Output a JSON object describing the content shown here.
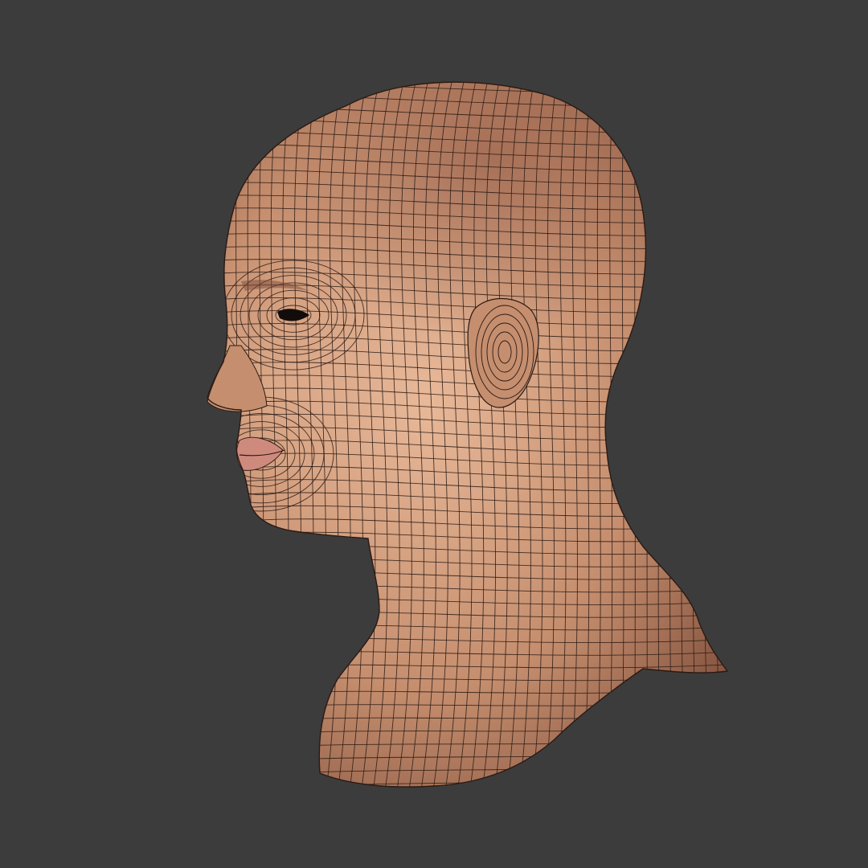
{
  "scene": {
    "subject": "head-bust-wireframe",
    "view": "three-quarter-left",
    "colors": {
      "background": "#3c3c3c",
      "skin_light": "#e8b999",
      "skin_mid": "#c58e6e",
      "skin_dark": "#7a4a38",
      "scalp_tint": "#8a5442",
      "wire": "#2a1a14",
      "lips": "#cf8a7e",
      "eye": "#120d0b"
    }
  }
}
